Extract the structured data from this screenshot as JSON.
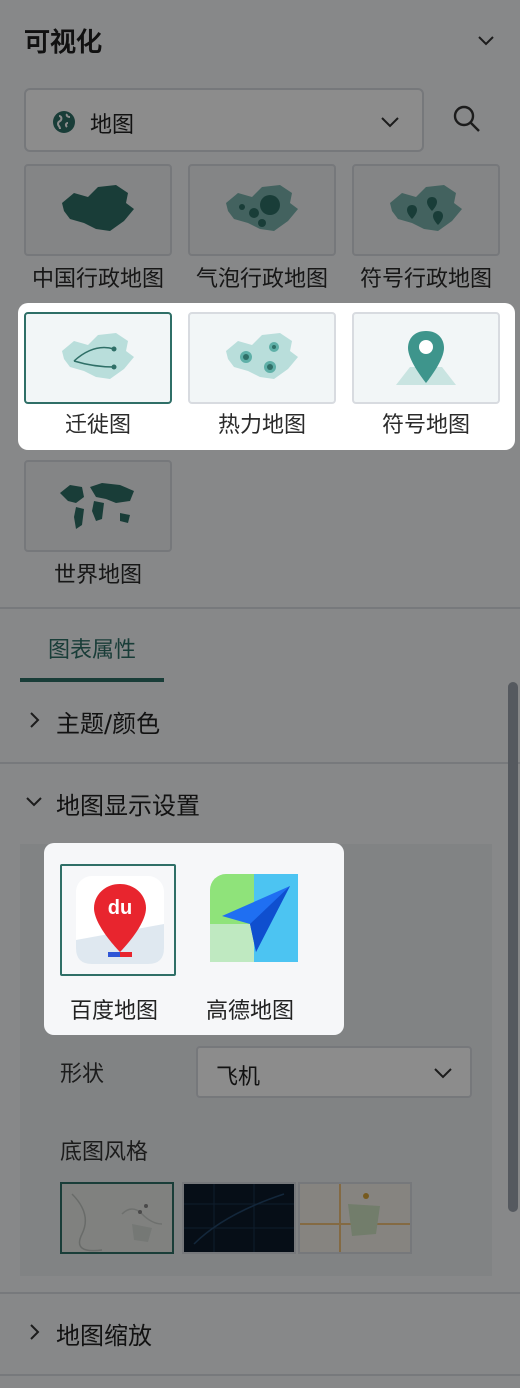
{
  "header": {
    "title": "可视化"
  },
  "chart_type_select": {
    "value": "地图"
  },
  "map_types": {
    "row1": [
      {
        "label": "中国行政地图"
      },
      {
        "label": "气泡行政地图"
      },
      {
        "label": "符号行政地图"
      }
    ],
    "row2": [
      {
        "label": "迁徙图",
        "selected": true
      },
      {
        "label": "热力地图"
      },
      {
        "label": "符号地图"
      }
    ],
    "row3": [
      {
        "label": "世界地图"
      }
    ]
  },
  "tabs": {
    "chart_properties": "图表属性"
  },
  "sections": {
    "theme_color": "主题/颜色",
    "map_display": "地图显示设置",
    "map_zoom": "地图缩放"
  },
  "map_display": {
    "providers": [
      {
        "label": "百度地图",
        "selected": true
      },
      {
        "label": "高德地图"
      }
    ],
    "baidu_logo_text": "du",
    "shape_label": "形状",
    "shape_value": "飞机",
    "basemap_style_label": "底图风格"
  },
  "colors": {
    "accent": "#2f6f67",
    "map_teal": "#4a9a93",
    "baidu_red": "#e8252e",
    "amap_blue": "#1f6ff2"
  }
}
